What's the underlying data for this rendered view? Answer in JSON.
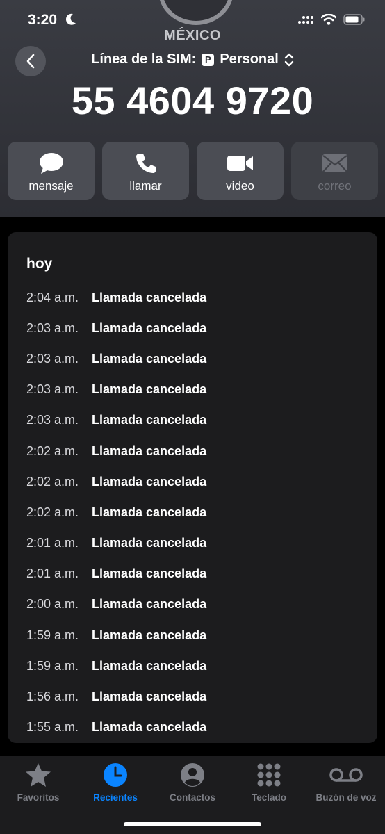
{
  "status_bar": {
    "time": "3:20"
  },
  "contact": {
    "country": "MÉXICO",
    "sim_prefix": "Línea de la SIM:",
    "sim_badge": "P",
    "sim_name": "Personal",
    "number": "55 4604 9720"
  },
  "actions": [
    {
      "label": "mensaje",
      "icon": "message-bubble-icon",
      "enabled": true
    },
    {
      "label": "llamar",
      "icon": "phone-icon",
      "enabled": true
    },
    {
      "label": "video",
      "icon": "video-camera-icon",
      "enabled": true
    },
    {
      "label": "correo",
      "icon": "envelope-icon",
      "enabled": false
    }
  ],
  "history": {
    "day": "hoy",
    "calls": [
      {
        "time": "2:04 a.m.",
        "status": "Llamada cancelada"
      },
      {
        "time": "2:03 a.m.",
        "status": "Llamada cancelada"
      },
      {
        "time": "2:03 a.m.",
        "status": "Llamada cancelada"
      },
      {
        "time": "2:03 a.m.",
        "status": "Llamada cancelada"
      },
      {
        "time": "2:03 a.m.",
        "status": "Llamada cancelada"
      },
      {
        "time": "2:02 a.m.",
        "status": "Llamada cancelada"
      },
      {
        "time": "2:02 a.m.",
        "status": "Llamada cancelada"
      },
      {
        "time": "2:02 a.m.",
        "status": "Llamada cancelada"
      },
      {
        "time": "2:01 a.m.",
        "status": "Llamada cancelada"
      },
      {
        "time": "2:01 a.m.",
        "status": "Llamada cancelada"
      },
      {
        "time": "2:00 a.m.",
        "status": "Llamada cancelada"
      },
      {
        "time": "1:59 a.m.",
        "status": "Llamada cancelada"
      },
      {
        "time": "1:59 a.m.",
        "status": "Llamada cancelada"
      },
      {
        "time": "1:56 a.m.",
        "status": "Llamada cancelada"
      },
      {
        "time": "1:55 a.m.",
        "status": "Llamada cancelada"
      }
    ]
  },
  "tabs": [
    {
      "label": "Favoritos",
      "icon": "star-icon",
      "active": false
    },
    {
      "label": "Recientes",
      "icon": "clock-icon",
      "active": true
    },
    {
      "label": "Contactos",
      "icon": "person-circle-icon",
      "active": false
    },
    {
      "label": "Teclado",
      "icon": "keypad-icon",
      "active": false
    },
    {
      "label": "Buzón de voz",
      "icon": "voicemail-icon",
      "active": false
    }
  ],
  "colors": {
    "accent": "#0a84ff",
    "card": "#1c1c1e",
    "button": "#4b4d54"
  }
}
